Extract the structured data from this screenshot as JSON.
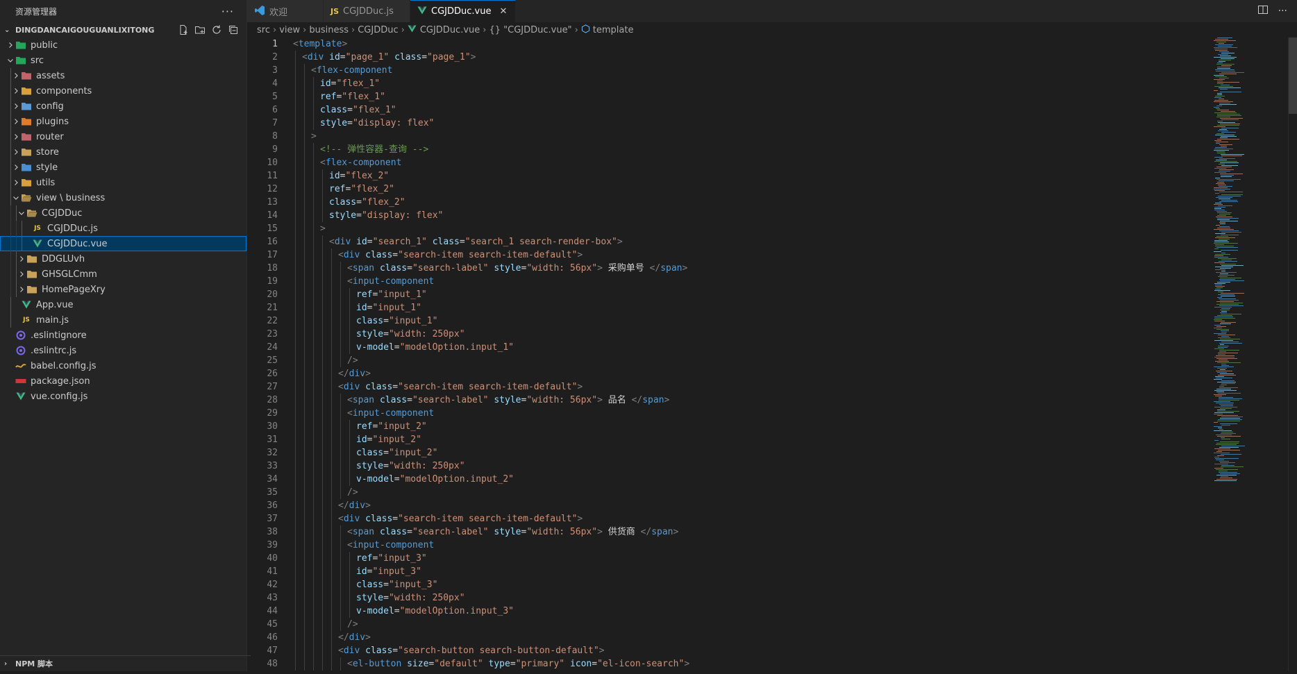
{
  "sidebar": {
    "title": "资源管理器",
    "more_icon": "ellipsis-icon",
    "project": "DINGDANCAIGOUGUANLIXITONG",
    "tree": [
      {
        "label": "public",
        "depth": 1,
        "twist": "chevron-right",
        "icon": "folder-public-icon",
        "icolor": "#23a55a"
      },
      {
        "label": "src",
        "depth": 1,
        "twist": "chevron-down",
        "icon": "folder-src-icon",
        "icolor": "#23a55a"
      },
      {
        "label": "assets",
        "depth": 2,
        "twist": "chevron-right",
        "icon": "folder-assets-icon",
        "icolor": "#c0636b"
      },
      {
        "label": "components",
        "depth": 2,
        "twist": "chevron-right",
        "icon": "folder-components-icon",
        "icolor": "#d9a13b"
      },
      {
        "label": "config",
        "depth": 2,
        "twist": "chevron-right",
        "icon": "folder-config-icon",
        "icolor": "#5b9bd5"
      },
      {
        "label": "plugins",
        "depth": 2,
        "twist": "chevron-right",
        "icon": "folder-plugins-icon",
        "icolor": "#e07b2a"
      },
      {
        "label": "router",
        "depth": 2,
        "twist": "chevron-right",
        "icon": "folder-router-icon",
        "icolor": "#c0636b"
      },
      {
        "label": "store",
        "depth": 2,
        "twist": "chevron-right",
        "icon": "folder-store-icon",
        "icolor": "#c8a25a"
      },
      {
        "label": "style",
        "depth": 2,
        "twist": "chevron-right",
        "icon": "folder-style-icon",
        "icolor": "#4a8fd4"
      },
      {
        "label": "utils",
        "depth": 2,
        "twist": "chevron-right",
        "icon": "folder-utils-icon",
        "icolor": "#d9a13b"
      },
      {
        "label": "view \\ business",
        "depth": 2,
        "twist": "chevron-down",
        "icon": "folder-open-icon",
        "icolor": "#c8a25a"
      },
      {
        "label": "CGJDDuc",
        "depth": 3,
        "twist": "chevron-down",
        "icon": "folder-open-icon",
        "icolor": "#c8a25a"
      },
      {
        "label": "CGJDDuc.js",
        "depth": 4,
        "twist": "",
        "icon": "js-file-icon",
        "icolor": "#e8c547"
      },
      {
        "label": "CGJDDuc.vue",
        "depth": 4,
        "twist": "",
        "icon": "vue-file-icon",
        "icolor": "#41b883",
        "selected": true
      },
      {
        "label": "DDGLUvh",
        "depth": 3,
        "twist": "chevron-right",
        "icon": "folder-icon",
        "icolor": "#c8a25a"
      },
      {
        "label": "GHSGLCmm",
        "depth": 3,
        "twist": "chevron-right",
        "icon": "folder-icon",
        "icolor": "#c8a25a"
      },
      {
        "label": "HomePageXry",
        "depth": 3,
        "twist": "chevron-right",
        "icon": "folder-icon",
        "icolor": "#c8a25a"
      },
      {
        "label": "App.vue",
        "depth": 2,
        "twist": "",
        "icon": "vue-file-icon",
        "icolor": "#41b883"
      },
      {
        "label": "main.js",
        "depth": 2,
        "twist": "",
        "icon": "js-file-icon",
        "icolor": "#e8c547"
      },
      {
        "label": ".eslintignore",
        "depth": 1,
        "twist": "",
        "icon": "eslint-icon",
        "icolor": "#7b68ee"
      },
      {
        "label": ".eslintrc.js",
        "depth": 1,
        "twist": "",
        "icon": "eslint-icon",
        "icolor": "#7b68ee"
      },
      {
        "label": "babel.config.js",
        "depth": 1,
        "twist": "",
        "icon": "babel-icon",
        "icolor": "#d9a13b"
      },
      {
        "label": "package.json",
        "depth": 1,
        "twist": "",
        "icon": "npm-icon",
        "icolor": "#cb3837"
      },
      {
        "label": "vue.config.js",
        "depth": 1,
        "twist": "",
        "icon": "vue-file-icon",
        "icolor": "#41b883"
      }
    ],
    "npm_section": "NPM 脚本"
  },
  "tabs": [
    {
      "label": "欢迎",
      "icon": "vscode-icon",
      "icolor": "#3c99dc",
      "active": false
    },
    {
      "label": "CGJDDuc.js",
      "icon": "js-file-icon",
      "icolor": "#e8c547",
      "active": false
    },
    {
      "label": "CGJDDuc.vue",
      "icon": "vue-file-icon",
      "icolor": "#41b883",
      "active": true
    }
  ],
  "breadcrumb": [
    "src",
    "view",
    "business",
    "CGJDDuc",
    "CGJDDuc.vue",
    "{} \"CGJDDuc.vue\"",
    "template"
  ],
  "code_lines": [
    [
      0,
      [
        [
          "t-punc",
          "<"
        ],
        [
          "t-tag",
          "template"
        ],
        [
          "t-punc",
          ">"
        ]
      ]
    ],
    [
      1,
      [
        [
          "t-punc",
          "<"
        ],
        [
          "t-tag",
          "div"
        ],
        [
          "t-txt",
          " "
        ],
        [
          "t-attr",
          "id"
        ],
        [
          "t-txt",
          "="
        ],
        [
          "t-str",
          "\"page_1\""
        ],
        [
          "t-txt",
          " "
        ],
        [
          "t-attr",
          "class"
        ],
        [
          "t-txt",
          "="
        ],
        [
          "t-str",
          "\"page_1\""
        ],
        [
          "t-punc",
          ">"
        ]
      ]
    ],
    [
      2,
      [
        [
          "t-punc",
          "<"
        ],
        [
          "t-tag",
          "flex-component"
        ]
      ]
    ],
    [
      3,
      [
        [
          "t-attr",
          "id"
        ],
        [
          "t-txt",
          "="
        ],
        [
          "t-str",
          "\"flex_1\""
        ]
      ]
    ],
    [
      3,
      [
        [
          "t-attr",
          "ref"
        ],
        [
          "t-txt",
          "="
        ],
        [
          "t-str",
          "\"flex_1\""
        ]
      ]
    ],
    [
      3,
      [
        [
          "t-attr",
          "class"
        ],
        [
          "t-txt",
          "="
        ],
        [
          "t-str",
          "\"flex_1\""
        ]
      ]
    ],
    [
      3,
      [
        [
          "t-attr",
          "style"
        ],
        [
          "t-txt",
          "="
        ],
        [
          "t-str",
          "\"display: flex\""
        ]
      ]
    ],
    [
      2,
      [
        [
          "t-punc",
          ">"
        ]
      ]
    ],
    [
      3,
      [
        [
          "t-cmt",
          "<!-- 弹性容器-查询 -->"
        ]
      ]
    ],
    [
      3,
      [
        [
          "t-punc",
          "<"
        ],
        [
          "t-tag",
          "flex-component"
        ]
      ]
    ],
    [
      4,
      [
        [
          "t-attr",
          "id"
        ],
        [
          "t-txt",
          "="
        ],
        [
          "t-str",
          "\"flex_2\""
        ]
      ]
    ],
    [
      4,
      [
        [
          "t-attr",
          "ref"
        ],
        [
          "t-txt",
          "="
        ],
        [
          "t-str",
          "\"flex_2\""
        ]
      ]
    ],
    [
      4,
      [
        [
          "t-attr",
          "class"
        ],
        [
          "t-txt",
          "="
        ],
        [
          "t-str",
          "\"flex_2\""
        ]
      ]
    ],
    [
      4,
      [
        [
          "t-attr",
          "style"
        ],
        [
          "t-txt",
          "="
        ],
        [
          "t-str",
          "\"display: flex\""
        ]
      ]
    ],
    [
      3,
      [
        [
          "t-punc",
          ">"
        ]
      ]
    ],
    [
      4,
      [
        [
          "t-punc",
          "<"
        ],
        [
          "t-tag",
          "div"
        ],
        [
          "t-txt",
          " "
        ],
        [
          "t-attr",
          "id"
        ],
        [
          "t-txt",
          "="
        ],
        [
          "t-str",
          "\"search_1\""
        ],
        [
          "t-txt",
          " "
        ],
        [
          "t-attr",
          "class"
        ],
        [
          "t-txt",
          "="
        ],
        [
          "t-str",
          "\"search_1 search-render-box\""
        ],
        [
          "t-punc",
          ">"
        ]
      ]
    ],
    [
      5,
      [
        [
          "t-punc",
          "<"
        ],
        [
          "t-tag",
          "div"
        ],
        [
          "t-txt",
          " "
        ],
        [
          "t-attr",
          "class"
        ],
        [
          "t-txt",
          "="
        ],
        [
          "t-str",
          "\"search-item search-item-default\""
        ],
        [
          "t-punc",
          ">"
        ]
      ]
    ],
    [
      6,
      [
        [
          "t-punc",
          "<"
        ],
        [
          "t-tag",
          "span"
        ],
        [
          "t-txt",
          " "
        ],
        [
          "t-attr",
          "class"
        ],
        [
          "t-txt",
          "="
        ],
        [
          "t-str",
          "\"search-label\""
        ],
        [
          "t-txt",
          " "
        ],
        [
          "t-attr",
          "style"
        ],
        [
          "t-txt",
          "="
        ],
        [
          "t-str",
          "\"width: 56px\""
        ],
        [
          "t-punc",
          ">"
        ],
        [
          "t-txt",
          " 采购单号 "
        ],
        [
          "t-punc",
          "</"
        ],
        [
          "t-tag",
          "span"
        ],
        [
          "t-punc",
          ">"
        ]
      ]
    ],
    [
      6,
      [
        [
          "t-punc",
          "<"
        ],
        [
          "t-tag",
          "input-component"
        ]
      ]
    ],
    [
      7,
      [
        [
          "t-attr",
          "ref"
        ],
        [
          "t-txt",
          "="
        ],
        [
          "t-str",
          "\"input_1\""
        ]
      ]
    ],
    [
      7,
      [
        [
          "t-attr",
          "id"
        ],
        [
          "t-txt",
          "="
        ],
        [
          "t-str",
          "\"input_1\""
        ]
      ]
    ],
    [
      7,
      [
        [
          "t-attr",
          "class"
        ],
        [
          "t-txt",
          "="
        ],
        [
          "t-str",
          "\"input_1\""
        ]
      ]
    ],
    [
      7,
      [
        [
          "t-attr",
          "style"
        ],
        [
          "t-txt",
          "="
        ],
        [
          "t-str",
          "\"width: 250px\""
        ]
      ]
    ],
    [
      7,
      [
        [
          "t-attr",
          "v-model"
        ],
        [
          "t-txt",
          "="
        ],
        [
          "t-str",
          "\"modelOption.input_1\""
        ]
      ]
    ],
    [
      6,
      [
        [
          "t-punc",
          "/>"
        ]
      ]
    ],
    [
      5,
      [
        [
          "t-punc",
          "</"
        ],
        [
          "t-tag",
          "div"
        ],
        [
          "t-punc",
          ">"
        ]
      ]
    ],
    [
      5,
      [
        [
          "t-punc",
          "<"
        ],
        [
          "t-tag",
          "div"
        ],
        [
          "t-txt",
          " "
        ],
        [
          "t-attr",
          "class"
        ],
        [
          "t-txt",
          "="
        ],
        [
          "t-str",
          "\"search-item search-item-default\""
        ],
        [
          "t-punc",
          ">"
        ]
      ]
    ],
    [
      6,
      [
        [
          "t-punc",
          "<"
        ],
        [
          "t-tag",
          "span"
        ],
        [
          "t-txt",
          " "
        ],
        [
          "t-attr",
          "class"
        ],
        [
          "t-txt",
          "="
        ],
        [
          "t-str",
          "\"search-label\""
        ],
        [
          "t-txt",
          " "
        ],
        [
          "t-attr",
          "style"
        ],
        [
          "t-txt",
          "="
        ],
        [
          "t-str",
          "\"width: 56px\""
        ],
        [
          "t-punc",
          ">"
        ],
        [
          "t-txt",
          " 品名 "
        ],
        [
          "t-punc",
          "</"
        ],
        [
          "t-tag",
          "span"
        ],
        [
          "t-punc",
          ">"
        ]
      ]
    ],
    [
      6,
      [
        [
          "t-punc",
          "<"
        ],
        [
          "t-tag",
          "input-component"
        ]
      ]
    ],
    [
      7,
      [
        [
          "t-attr",
          "ref"
        ],
        [
          "t-txt",
          "="
        ],
        [
          "t-str",
          "\"input_2\""
        ]
      ]
    ],
    [
      7,
      [
        [
          "t-attr",
          "id"
        ],
        [
          "t-txt",
          "="
        ],
        [
          "t-str",
          "\"input_2\""
        ]
      ]
    ],
    [
      7,
      [
        [
          "t-attr",
          "class"
        ],
        [
          "t-txt",
          "="
        ],
        [
          "t-str",
          "\"input_2\""
        ]
      ]
    ],
    [
      7,
      [
        [
          "t-attr",
          "style"
        ],
        [
          "t-txt",
          "="
        ],
        [
          "t-str",
          "\"width: 250px\""
        ]
      ]
    ],
    [
      7,
      [
        [
          "t-attr",
          "v-model"
        ],
        [
          "t-txt",
          "="
        ],
        [
          "t-str",
          "\"modelOption.input_2\""
        ]
      ]
    ],
    [
      6,
      [
        [
          "t-punc",
          "/>"
        ]
      ]
    ],
    [
      5,
      [
        [
          "t-punc",
          "</"
        ],
        [
          "t-tag",
          "div"
        ],
        [
          "t-punc",
          ">"
        ]
      ]
    ],
    [
      5,
      [
        [
          "t-punc",
          "<"
        ],
        [
          "t-tag",
          "div"
        ],
        [
          "t-txt",
          " "
        ],
        [
          "t-attr",
          "class"
        ],
        [
          "t-txt",
          "="
        ],
        [
          "t-str",
          "\"search-item search-item-default\""
        ],
        [
          "t-punc",
          ">"
        ]
      ]
    ],
    [
      6,
      [
        [
          "t-punc",
          "<"
        ],
        [
          "t-tag",
          "span"
        ],
        [
          "t-txt",
          " "
        ],
        [
          "t-attr",
          "class"
        ],
        [
          "t-txt",
          "="
        ],
        [
          "t-str",
          "\"search-label\""
        ],
        [
          "t-txt",
          " "
        ],
        [
          "t-attr",
          "style"
        ],
        [
          "t-txt",
          "="
        ],
        [
          "t-str",
          "\"width: 56px\""
        ],
        [
          "t-punc",
          ">"
        ],
        [
          "t-txt",
          " 供货商 "
        ],
        [
          "t-punc",
          "</"
        ],
        [
          "t-tag",
          "span"
        ],
        [
          "t-punc",
          ">"
        ]
      ]
    ],
    [
      6,
      [
        [
          "t-punc",
          "<"
        ],
        [
          "t-tag",
          "input-component"
        ]
      ]
    ],
    [
      7,
      [
        [
          "t-attr",
          "ref"
        ],
        [
          "t-txt",
          "="
        ],
        [
          "t-str",
          "\"input_3\""
        ]
      ]
    ],
    [
      7,
      [
        [
          "t-attr",
          "id"
        ],
        [
          "t-txt",
          "="
        ],
        [
          "t-str",
          "\"input_3\""
        ]
      ]
    ],
    [
      7,
      [
        [
          "t-attr",
          "class"
        ],
        [
          "t-txt",
          "="
        ],
        [
          "t-str",
          "\"input_3\""
        ]
      ]
    ],
    [
      7,
      [
        [
          "t-attr",
          "style"
        ],
        [
          "t-txt",
          "="
        ],
        [
          "t-str",
          "\"width: 250px\""
        ]
      ]
    ],
    [
      7,
      [
        [
          "t-attr",
          "v-model"
        ],
        [
          "t-txt",
          "="
        ],
        [
          "t-str",
          "\"modelOption.input_3\""
        ]
      ]
    ],
    [
      6,
      [
        [
          "t-punc",
          "/>"
        ]
      ]
    ],
    [
      5,
      [
        [
          "t-punc",
          "</"
        ],
        [
          "t-tag",
          "div"
        ],
        [
          "t-punc",
          ">"
        ]
      ]
    ],
    [
      5,
      [
        [
          "t-punc",
          "<"
        ],
        [
          "t-tag",
          "div"
        ],
        [
          "t-txt",
          " "
        ],
        [
          "t-attr",
          "class"
        ],
        [
          "t-txt",
          "="
        ],
        [
          "t-str",
          "\"search-button search-button-default\""
        ],
        [
          "t-punc",
          ">"
        ]
      ]
    ],
    [
      6,
      [
        [
          "t-punc",
          "<"
        ],
        [
          "t-tag",
          "el-button"
        ],
        [
          "t-txt",
          " "
        ],
        [
          "t-attr",
          "size"
        ],
        [
          "t-txt",
          "="
        ],
        [
          "t-str",
          "\"default\""
        ],
        [
          "t-txt",
          " "
        ],
        [
          "t-attr",
          "type"
        ],
        [
          "t-txt",
          "="
        ],
        [
          "t-str",
          "\"primary\""
        ],
        [
          "t-txt",
          " "
        ],
        [
          "t-attr",
          "icon"
        ],
        [
          "t-txt",
          "="
        ],
        [
          "t-str",
          "\"el-icon-search\""
        ],
        [
          "t-punc",
          ">"
        ]
      ]
    ]
  ]
}
